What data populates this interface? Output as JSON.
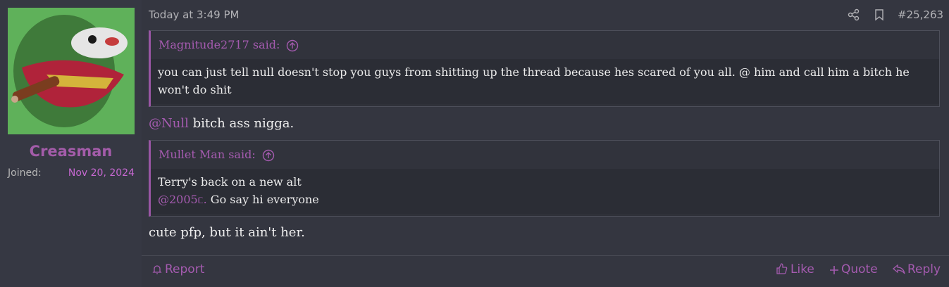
{
  "user": {
    "name": "Creasman",
    "joined_label": "Joined:",
    "joined_value": "Nov 20, 2024",
    "avatar_icon": "frog-avatar-icon"
  },
  "post": {
    "timestamp": "Today at 3:49 PM",
    "number": "#25,263",
    "quotes": [
      {
        "author": "Magnitude2717 said:",
        "text": "you can just tell null doesn't stop you guys from shitting up the thread because hes scared of you all. @ him and call him a bitch he won't do shit"
      },
      {
        "author": "Mullet Man said:",
        "line1": "Terry's back on a new alt",
        "mention": "@2005ᥴ.",
        "line2_rest": " Go say hi everyone"
      }
    ],
    "line1_mention": "@Null",
    "line1_rest": " bitch ass nigga.",
    "line2": "cute pfp, but it ain't her."
  },
  "footer": {
    "report": "Report",
    "like": "Like",
    "quote": "Quote",
    "reply": "Reply"
  },
  "colors": {
    "accent": "#a55bb0",
    "joined": "#c668d1",
    "background": "#363843"
  }
}
